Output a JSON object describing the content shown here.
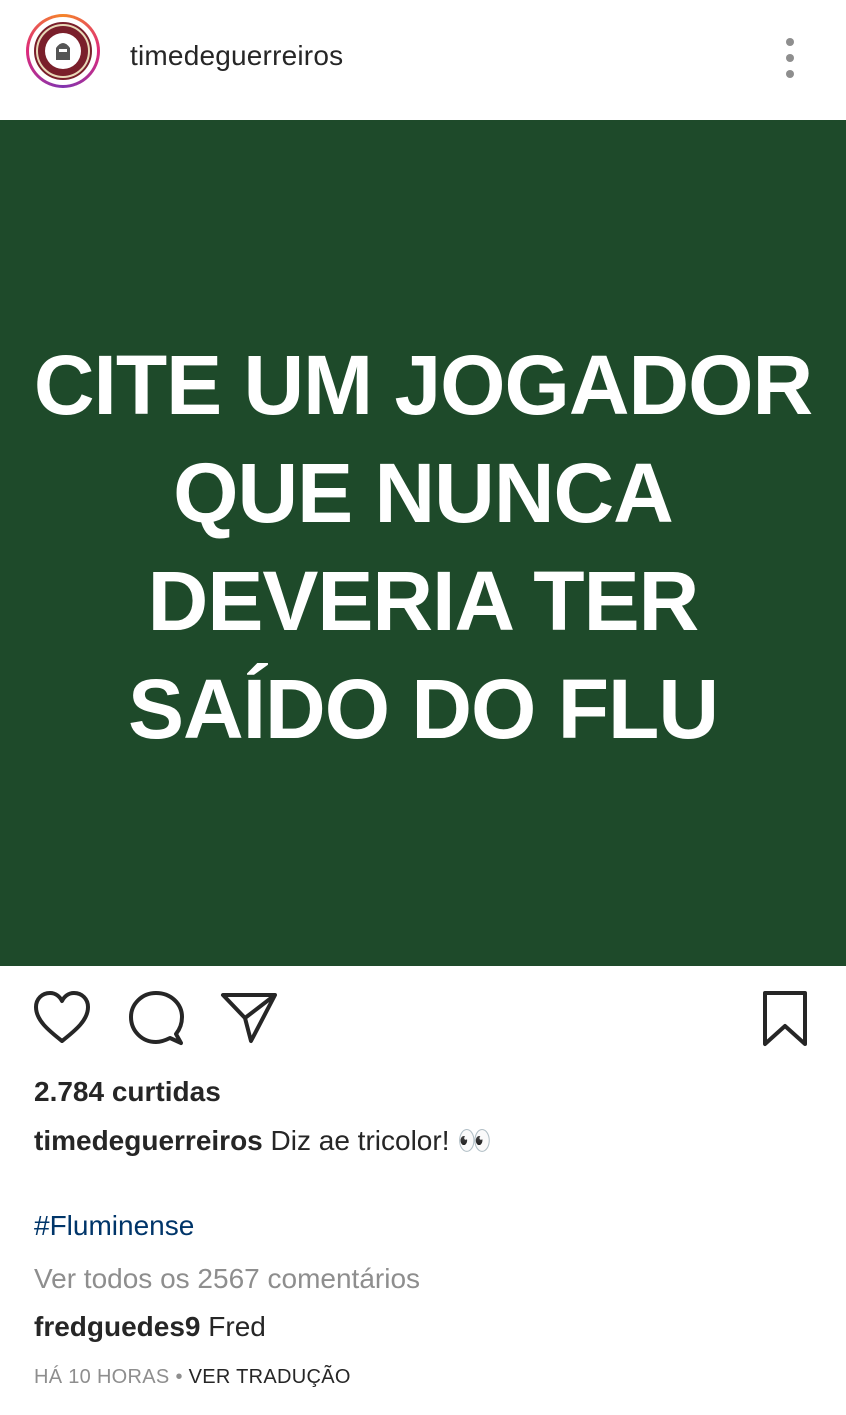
{
  "colors": {
    "post_background": "#1e4a2a",
    "text": "#262626",
    "muted": "#8e8e8e",
    "hashtag": "#003569",
    "avatar_primary": "#7a1f2b"
  },
  "header": {
    "username": "timedeguerreiros",
    "avatar_icon": "team-crest-avatar",
    "menu_icon": "more-vertical-icon"
  },
  "post": {
    "lines": [
      "CITE UM JOGADOR",
      "QUE NUNCA",
      "DEVERIA TER",
      "SAÍDO DO FLU"
    ]
  },
  "actions": {
    "like_icon": "heart-icon",
    "comment_icon": "comment-icon",
    "share_icon": "send-icon",
    "save_icon": "bookmark-icon"
  },
  "likes": "2.784 curtidas",
  "caption": {
    "username": "timedeguerreiros",
    "text": "Diz ae tricolor! 👀"
  },
  "hashtag": "#Fluminense",
  "view_all_comments": "Ver todos os 2567 comentários",
  "comment": {
    "username": "fredguedes9",
    "text": "Fred"
  },
  "footer": {
    "time": "HÁ 10 HORAS",
    "separator": "•",
    "translate": "VER TRADUÇÃO"
  }
}
